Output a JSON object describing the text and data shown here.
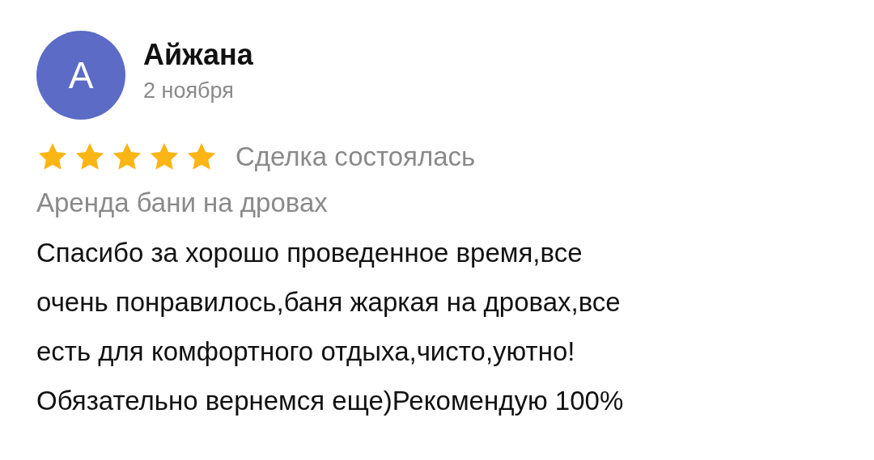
{
  "review": {
    "avatar_letter": "А",
    "author": "Айжана",
    "date": "2 ноября",
    "stars": 5,
    "deal_status": "Сделка состоялась",
    "listing": "Аренда бани на дровах",
    "text": "Спасибо за хорошо проведенное время,все\nочень понравилось,баня жаркая на дровах,все\nесть для комфортного отдыха,чисто,уютно!\nОбязательно вернемся еще)Рекомендую 100%"
  }
}
